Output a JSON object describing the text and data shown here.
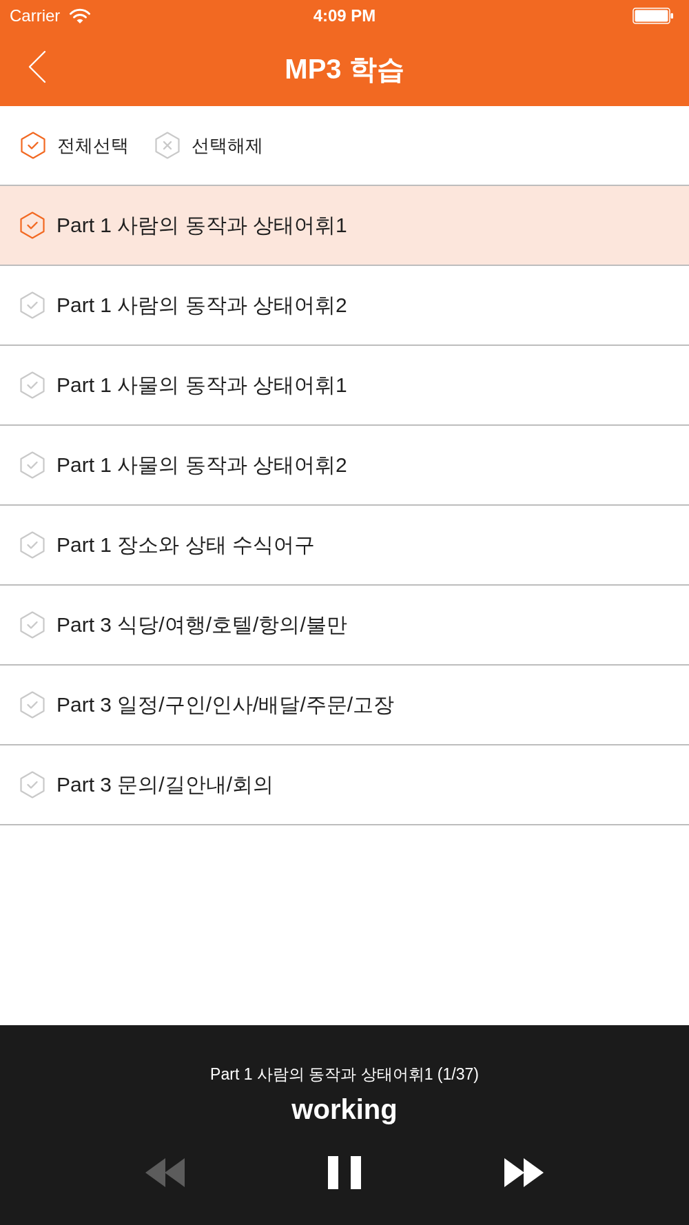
{
  "status_bar": {
    "carrier": "Carrier",
    "time": "4:09 PM"
  },
  "nav_bar": {
    "title": "MP3 학습"
  },
  "selection_actions": [
    {
      "kind": "select_all",
      "label": "전체선택"
    },
    {
      "kind": "deselect",
      "label": "선택해제"
    }
  ],
  "tracks": [
    {
      "title": "Part 1 사람의 동작과 상태어휘1",
      "selected": true
    },
    {
      "title": "Part 1 사람의 동작과 상태어휘2",
      "selected": false
    },
    {
      "title": "Part 1 사물의 동작과 상태어휘1",
      "selected": false
    },
    {
      "title": "Part 1 사물의 동작과 상태어휘2",
      "selected": false
    },
    {
      "title": "Part 1 장소와 상태 수식어구",
      "selected": false
    },
    {
      "title": "Part 3 식당/여행/호텔/항의/불만",
      "selected": false
    },
    {
      "title": "Part 3 일정/구인/인사/배달/주문/고장",
      "selected": false
    },
    {
      "title": "Part 3 문의/길안내/회의",
      "selected": false
    }
  ],
  "player": {
    "now_playing": "Part 1 사람의 동작과 상태어휘1 (1/37)",
    "word": "working",
    "controls": [
      {
        "kind": "rewind",
        "disabled": true
      },
      {
        "kind": "pause",
        "disabled": false
      },
      {
        "kind": "fast_forward",
        "disabled": false
      }
    ]
  }
}
